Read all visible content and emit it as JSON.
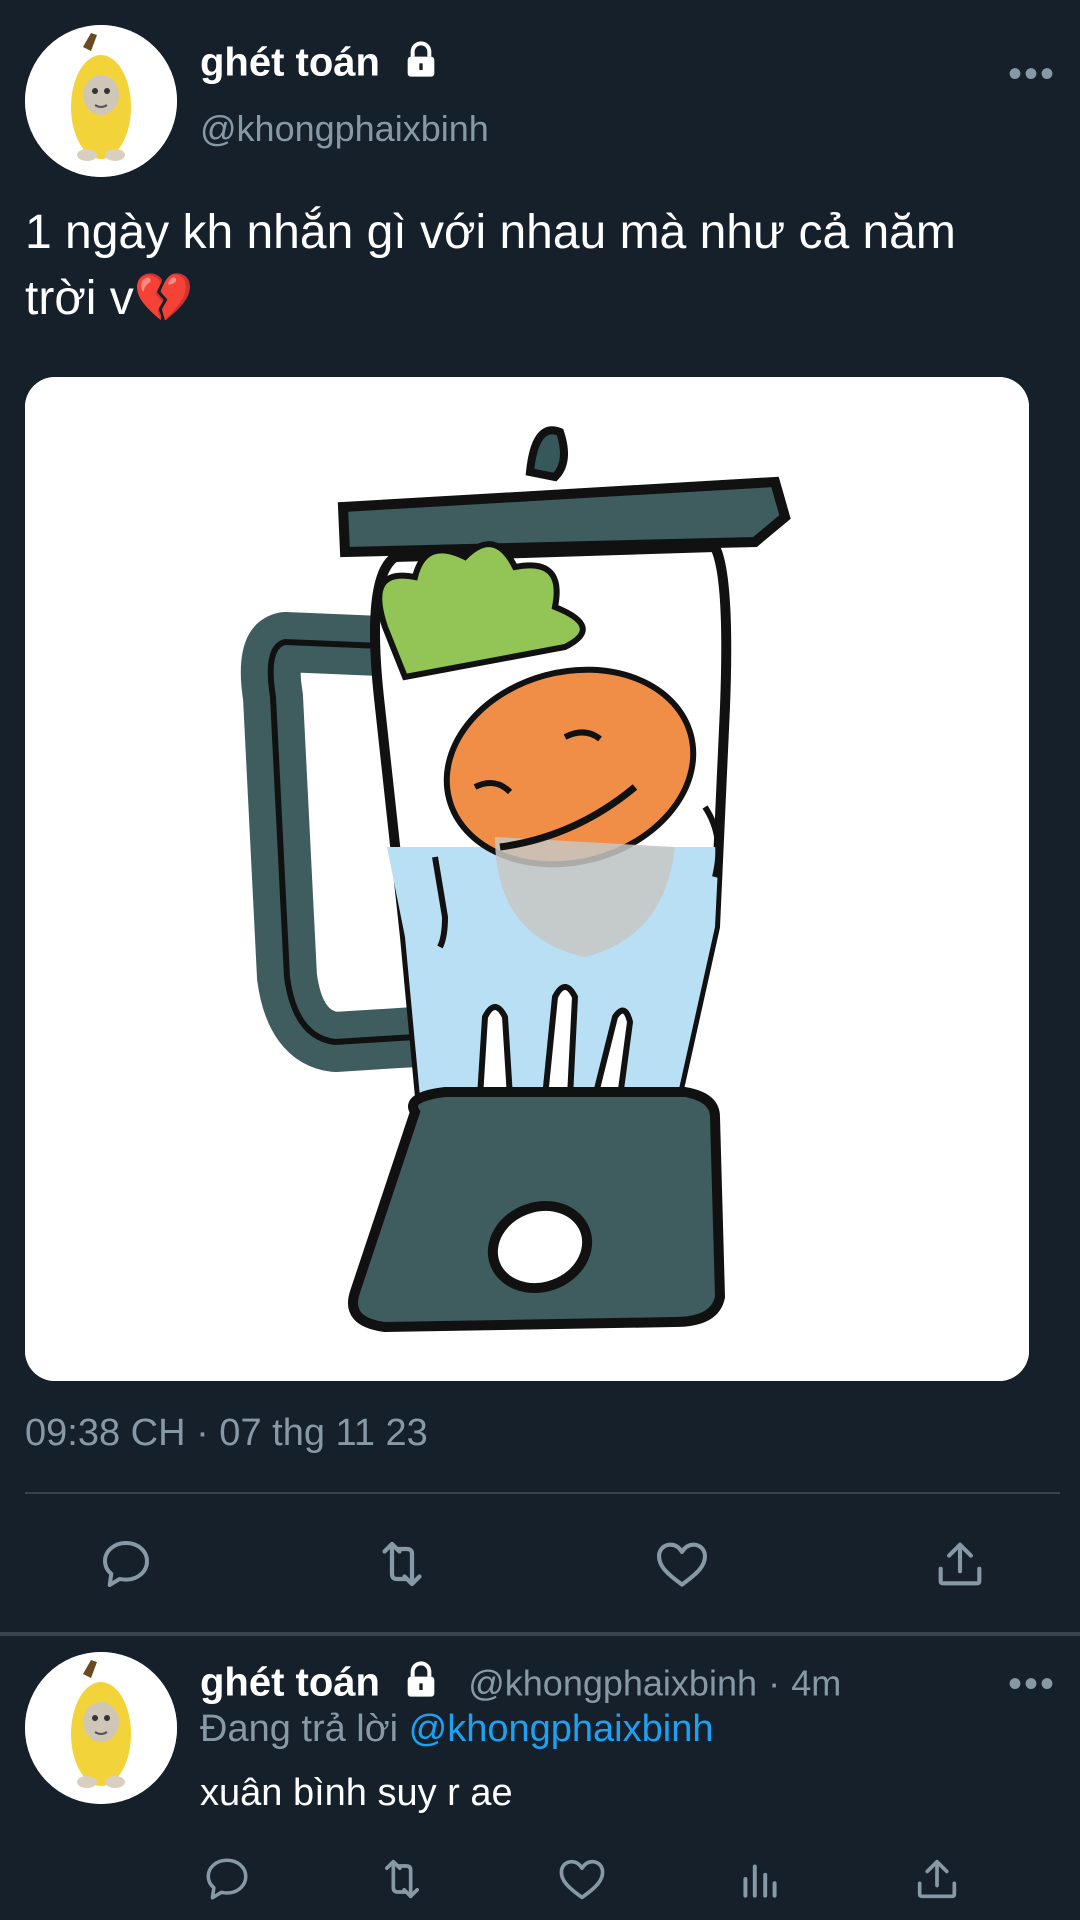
{
  "tweet": {
    "author_name": "ghét toán",
    "author_handle": "@khongphaixbinh",
    "more_label": "•••",
    "text_line1": "1 ngày kh nhắn gì với nhau mà như cả năm",
    "text_line2": "trời v",
    "emoji": "💔",
    "timestamp": "09:38 CH · 07 thg 11 23",
    "actions": [
      "reply-icon",
      "retweet-icon",
      "like-icon",
      "share-icon"
    ]
  },
  "reply": {
    "author_name": "ghét toán",
    "author_handle": "@khongphaixbinh",
    "time_sep": "·",
    "time": "4m",
    "replying_to_label": "Đang trả lời",
    "replying_to_handle": "@khongphaixbinh",
    "more_label": "•••",
    "text": "xuân bình suy r ae",
    "actions": [
      "reply-icon",
      "retweet-icon",
      "like-icon",
      "analytics-icon",
      "share-icon"
    ]
  },
  "colors": {
    "background": "#15202b",
    "secondary_text": "#8899a6",
    "accent": "#1da1f2",
    "divider": "#38444d"
  }
}
